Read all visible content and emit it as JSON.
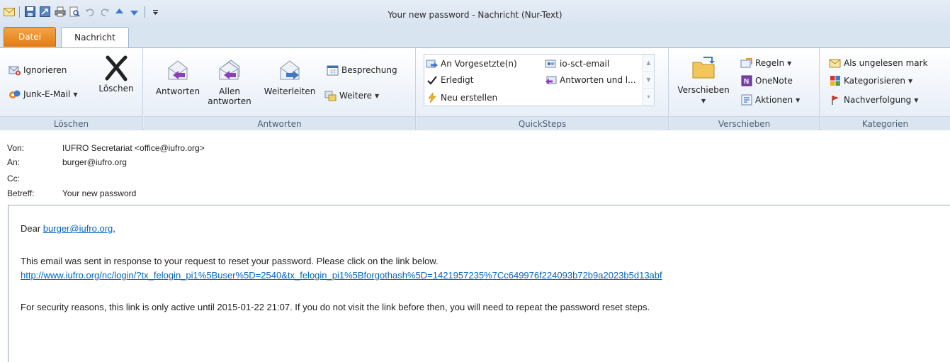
{
  "window": {
    "title": "Your new password  -  Nachricht (Nur-Text)"
  },
  "qat": {
    "icons": [
      "mail-icon",
      "save-icon",
      "forward-arrow-icon",
      "print-icon",
      "print-preview-icon",
      "undo-icon",
      "redo-icon",
      "up-arrow-icon",
      "down-arrow-icon",
      "customize-icon"
    ]
  },
  "tabs": {
    "file": "Datei",
    "message": "Nachricht"
  },
  "ribbon": {
    "loeschen": {
      "label": "Löschen",
      "ignore": "Ignorieren",
      "junk": "Junk-E-Mail",
      "delete": "Löschen"
    },
    "antworten": {
      "label": "Antworten",
      "reply": "Antworten",
      "reply_all_line1": "Allen",
      "reply_all_line2": "antworten",
      "forward": "Weiterleiten",
      "meeting": "Besprechung",
      "more": "Weitere"
    },
    "quicksteps": {
      "label": "QuickSteps",
      "items": [
        "An Vorgesetzte(n)",
        "io-sct-email",
        "Erledigt",
        "Antworten und l...",
        "Neu erstellen"
      ]
    },
    "verschieben": {
      "label": "Verschieben",
      "move": "Verschieben",
      "rules": "Regeln",
      "onenote": "OneNote",
      "actions": "Aktionen"
    },
    "kategorien": {
      "label": "Kategorien",
      "unread": "Als ungelesen mark",
      "categorize": "Kategorisieren",
      "followup": "Nachverfolgung"
    }
  },
  "header": {
    "from_label": "Von:",
    "from_value": "IUFRO Secretariat <office@iufro.org>",
    "to_label": "An:",
    "to_value": "burger@iufro.org",
    "cc_label": "Cc:",
    "cc_value": "",
    "subject_label": "Betreff:",
    "subject_value": "Your new password"
  },
  "body": {
    "greeting_prefix": "Dear ",
    "greeting_link": "burger@iufro.org",
    "greeting_suffix": ",",
    "line1": "This email was sent in response to your request to reset your password. Please click on the link below.",
    "reset_link": "http://www.iufro.org/nc/login/?tx_felogin_pi1%5Buser%5D=2540&tx_felogin_pi1%5Bforgothash%5D=1421957235%7Cc649976f224093b72b9a2023b5d13abf",
    "line2": "For security reasons, this link is only active until 2015-01-22 21:07. If you do not visit the link before then, you will need to repeat the password reset steps."
  },
  "colors": {
    "file_tab": "#e27b14",
    "link": "#0563c1"
  }
}
